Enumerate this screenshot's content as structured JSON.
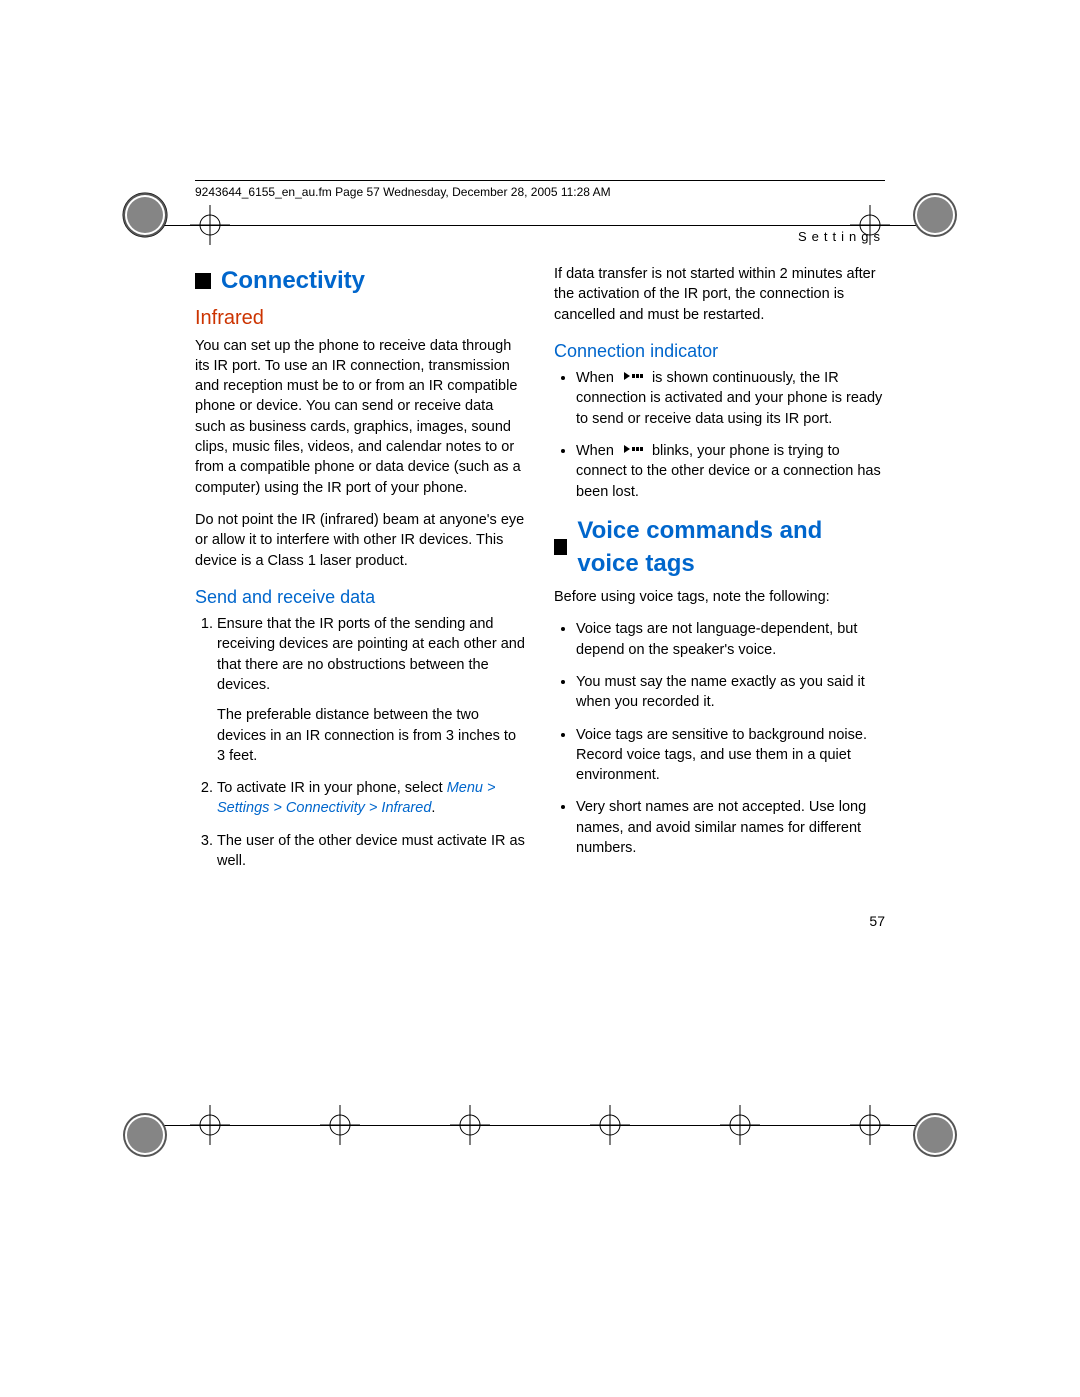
{
  "header": {
    "running": "9243644_6155_en_au.fm  Page 57  Wednesday, December 28, 2005  11:28 AM",
    "section": "Settings"
  },
  "left": {
    "h1": "Connectivity",
    "h2": "Infrared",
    "p1": "You can set up the phone to receive data through its IR port. To use an IR connection, transmission and reception must be to or from an IR compatible phone or device. You can send or receive data such as business cards, graphics, images, sound clips, music files, videos, and calendar notes to or from a compatible phone or data device (such as a computer) using the IR port of your phone.",
    "p2": "Do not point the IR (infrared) beam at anyone's eye or allow it to interfere with other IR devices. This device is a Class 1 laser product.",
    "h3": "Send and receive data",
    "ol1": "Ensure that the IR ports of the sending and receiving devices are pointing at each other and that there are no obstructions between the devices.",
    "ol1b": "The preferable distance between the two devices in an IR connection is from 3 inches to 3 feet.",
    "ol2a": "To activate IR in your phone, select ",
    "ol2b": "Menu > Settings > Connectivity > Infrared",
    "ol2c": ".",
    "ol3": "The user of the other device must activate IR as well."
  },
  "right": {
    "p1": "If data transfer is not started within 2 minutes after the activation of the IR port, the connection is cancelled and must be restarted.",
    "h3": "Connection indicator",
    "b1a": "When ",
    "b1b": " is shown continuously, the IR connection is activated and your phone is ready to send or receive data using its IR port.",
    "b2a": "When ",
    "b2b": " blinks, your phone is trying to connect to the other device or a connection has been lost.",
    "h1": "Voice commands and voice tags",
    "p2": "Before using voice tags, note the following:",
    "v1": "Voice tags are not language-dependent, but depend on the speaker's voice.",
    "v2": "You must say the name exactly as you said it when you recorded it.",
    "v3": "Voice tags are sensitive to background noise. Record voice tags, and use them in a quiet environment.",
    "v4": "Very short names are not accepted. Use long names, and avoid similar names for different numbers."
  },
  "page_number": "57"
}
